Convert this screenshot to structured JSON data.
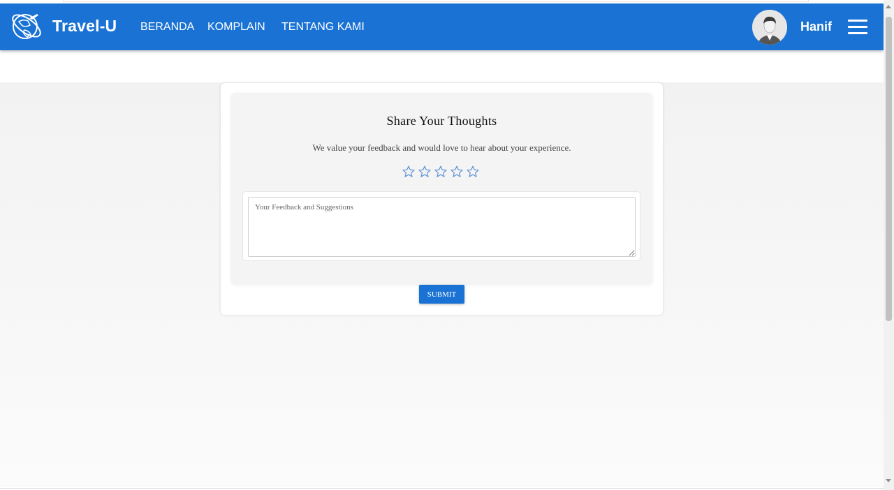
{
  "header": {
    "brand": "Travel-U",
    "nav": [
      {
        "label": "BERANDA"
      },
      {
        "label": "KOMPLAIN"
      },
      {
        "label": "TENTANG KAMI"
      }
    ],
    "user": {
      "name": "Hanif"
    }
  },
  "feedback": {
    "title": "Share Your Thoughts",
    "subtitle": "We value your feedback and would love to hear about your experience.",
    "rating": {
      "value": 0,
      "max": 5
    },
    "textarea_placeholder": "Your Feedback and Suggestions",
    "textarea_value": "",
    "submit_label": "SUBMIT"
  },
  "colors": {
    "primary": "#1a73d4",
    "star_outline": "#5b8ed6"
  }
}
